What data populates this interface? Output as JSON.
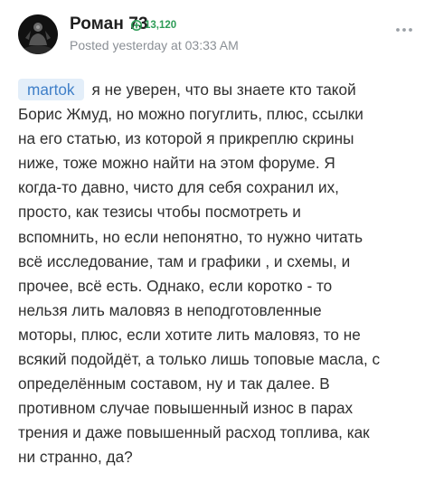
{
  "author": {
    "name": "Роман 73",
    "reputation": "13,120",
    "posted": "Posted yesterday at 03:33 AM"
  },
  "icons": {
    "avatar": "user-avatar",
    "reputation": "reputation-plus-icon",
    "more": "more-options-icon"
  },
  "colors": {
    "reputation_green": "#2e9c57",
    "mention_bg": "#e3eef9",
    "mention_text": "#3f7fc8",
    "meta_gray": "#8a8f95"
  },
  "post": {
    "mention": "martok",
    "first_line": "я не уверен, что вы знаете кто такой",
    "lines": [
      "Борис Жмуд, но можно погуглить, плюс, ссылки",
      "на его статью, из которой я прикреплю скрины",
      "ниже, тоже можно найти на этом форуме. Я",
      "когда-то давно, чисто для себя сохранил их,",
      "просто, как тезисы чтобы посмотреть и",
      "вспомнить, но если непонятно, то нужно читать",
      "всё исследование, там и графики , и схемы, и",
      "прочее, всё  есть. Однако, если коротко - то",
      "нельзя лить маловяз в неподготовленные",
      "моторы, плюс, если хотите лить маловяз, то не",
      "всякий подойдёт, а только лишь топовые масла, с",
      "определённым составом, ну и так далее. В",
      "противном случае повышенный износ в парах",
      "трения и даже повышенный расход топлива, как",
      "ни странно, да?"
    ]
  }
}
